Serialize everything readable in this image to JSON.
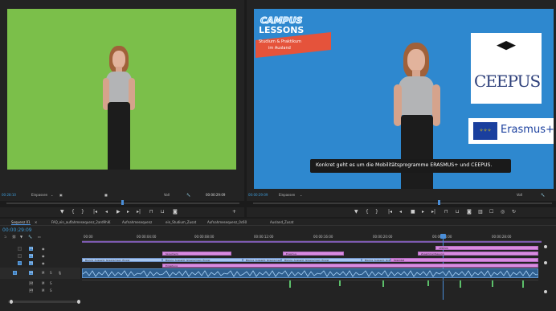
{
  "source_monitor": {
    "timecode_left": "00:28:10",
    "fit_label": "Einpassen",
    "scale_label": "Voll",
    "timecode_right": "00:00:29:09"
  },
  "program_monitor": {
    "timecode_left": "00:00:29:09",
    "fit_label": "Einpassen",
    "scale_label": "Voll",
    "subtitle": "Konkret geht es um die Mobilitätsprogramme ERASMUS+ und CEEPUS.",
    "campus_logo": {
      "line1": "CAMPUS",
      "line2": "LESSONS",
      "line3": "Studium & Praktikum",
      "line4": "im Ausland"
    },
    "ceepus_logo": "CEEPUS",
    "erasmus_logo": "Erasmus+"
  },
  "timeline": {
    "tabs": [
      "Sequenz 01",
      "FAQ_ein_auflahmesequenz_2ard9hiK",
      "Aufnahmesequenz",
      "ein_Studium_Zusat",
      "Aufnahmesequenz_0c60",
      "Ausland_Zusat"
    ],
    "timecode": "00:00:29:09",
    "ruler_labels": [
      "00:00",
      "00:00:04:00",
      "00:00:08:00",
      "00:00:12:00",
      "00:00:16:00",
      "00:00:20:00",
      "00:00:24:00",
      "00:00:28:00",
      "00:00:32:00"
    ],
    "track_labels": [
      "V3",
      "V2",
      "V1",
      "A1",
      "A2",
      "A3"
    ],
    "clips": {
      "v3_a": "Sprecherin",
      "v3_b": "Erasmus",
      "v3_c": "CEEPUS",
      "v2_a": "Einleitung",
      "v2_b": "Mobilität",
      "v2_c": "Zusammenfassung",
      "v1_1": "Bianca_Aussenb_Greenscreen_Einzel",
      "v1_2": "Bianca_Aussenb_Greenscreen_Einzel",
      "v1_3": "Bianca_Aussenb_Greenscreen_Einzel",
      "v1_4": "Bianca_Aussenb_Greenscreen_Einzel",
      "v1_5": "Bianca_Aussenb_Greenscreen_Einzel",
      "v1_6": "Bianca_Aussenb_Greenscreen_Einzel",
      "a1": "Hintergrund"
    }
  }
}
